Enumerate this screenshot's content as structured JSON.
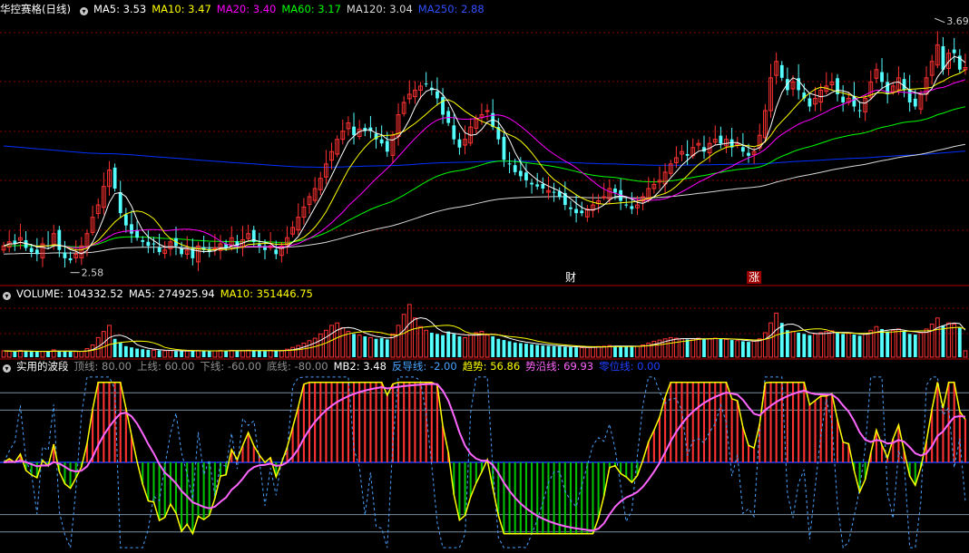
{
  "colors": {
    "up": "#ff3232",
    "down": "#54ffff",
    "ma5": "#ffffff",
    "ma10": "#ffff00",
    "ma20": "#ff00ff",
    "ma60": "#00ff00",
    "ma120": "#d8d8d8",
    "ma250": "#0030ff",
    "grid": "#8b0000",
    "axis": "#b00000"
  },
  "price_header": {
    "title": "华控赛格(日线)",
    "ma5": "MA5: 3.53",
    "ma10": "MA10: 3.47",
    "ma20": "MA20: 3.40",
    "ma60": "MA60: 3.17",
    "ma120": "MA120: 3.04",
    "ma250": "MA250: 2.88"
  },
  "volume_header": {
    "volume": "VOLUME: 104332.52",
    "ma5": "MA5: 274925.94",
    "ma10": "MA10: 351446.75"
  },
  "indicator_header": {
    "title": "实用的波段",
    "top": "顶线: 80.00",
    "upper": "上线: 60.00",
    "lower": "下线: -60.00",
    "bottom": "底线: -80.00",
    "mb2": "MB2: 3.48",
    "reverse": "反导线: -2.00",
    "trend": "趋势: 56.86",
    "edge": "势沿线: 69.93",
    "zero": "零位线: 0.00"
  },
  "chart_data": [
    {
      "type": "candlestick",
      "title": "华控赛格(日线)",
      "ylim": [
        2.48,
        3.78
      ],
      "annotations": [
        {
          "text": "3.69",
          "kind": "high"
        },
        {
          "text": "2.58",
          "kind": "low"
        },
        {
          "text": "财",
          "kind": "event"
        },
        {
          "text": "涨",
          "kind": "event"
        }
      ],
      "series": [
        {
          "name": "MA5",
          "value": 3.53
        },
        {
          "name": "MA10",
          "value": 3.47
        },
        {
          "name": "MA20",
          "value": 3.4
        },
        {
          "name": "MA60",
          "value": 3.17
        },
        {
          "name": "MA120",
          "value": 3.04
        },
        {
          "name": "MA250",
          "value": 2.88
        }
      ],
      "close": [
        2.66,
        2.68,
        2.67,
        2.7,
        2.65,
        2.63,
        2.62,
        2.67,
        2.66,
        2.72,
        2.64,
        2.6,
        2.59,
        2.62,
        2.66,
        2.72,
        2.8,
        2.86,
        2.95,
        3.03,
        2.94,
        2.82,
        2.76,
        2.72,
        2.7,
        2.68,
        2.66,
        2.67,
        2.63,
        2.64,
        2.68,
        2.66,
        2.62,
        2.64,
        2.6,
        2.66,
        2.64,
        2.63,
        2.65,
        2.67,
        2.65,
        2.7,
        2.66,
        2.69,
        2.72,
        2.68,
        2.66,
        2.64,
        2.66,
        2.62,
        2.66,
        2.7,
        2.75,
        2.8,
        2.85,
        2.9,
        2.94,
        2.99,
        3.06,
        3.12,
        3.18,
        3.22,
        3.26,
        3.2,
        3.23,
        3.22,
        3.22,
        3.18,
        3.16,
        3.12,
        3.2,
        3.3,
        3.36,
        3.4,
        3.42,
        3.44,
        3.45,
        3.42,
        3.38,
        3.3,
        3.26,
        3.18,
        3.14,
        3.18,
        3.24,
        3.28,
        3.3,
        3.32,
        3.24,
        3.18,
        3.08,
        3.06,
        3.02,
        3.0,
        2.98,
        2.96,
        2.95,
        2.94,
        2.93,
        2.92,
        2.9,
        2.86,
        2.84,
        2.82,
        2.82,
        2.84,
        2.86,
        2.88,
        2.9,
        2.94,
        2.92,
        2.88,
        2.86,
        2.84,
        2.86,
        2.9,
        2.94,
        2.96,
        2.98,
        3.02,
        3.06,
        3.09,
        3.12,
        3.1,
        3.14,
        3.16,
        3.12,
        3.16,
        3.18,
        3.16,
        3.18,
        3.14,
        3.16,
        3.12,
        3.1,
        3.12,
        3.2,
        3.32,
        3.48,
        3.56,
        3.48,
        3.42,
        3.46,
        3.42,
        3.38,
        3.34,
        3.38,
        3.42,
        3.44,
        3.46,
        3.4,
        3.36,
        3.38,
        3.34,
        3.32,
        3.38,
        3.46,
        3.52,
        3.46,
        3.4,
        3.44,
        3.48,
        3.42,
        3.36,
        3.34,
        3.4,
        3.48,
        3.56,
        3.64,
        3.52,
        3.6,
        3.6,
        3.52,
        3.53
      ],
      "volume": [
        104000,
        98000,
        92000,
        110000,
        96000,
        90000,
        88000,
        95000,
        92000,
        120000,
        100000,
        94000,
        90000,
        92000,
        96000,
        140000,
        200000,
        320000,
        420000,
        520000,
        300000,
        240000,
        180000,
        160000,
        140000,
        130000,
        120000,
        115000,
        110000,
        105000,
        108000,
        100000,
        96000,
        102000,
        110000,
        108000,
        100000,
        98000,
        104000,
        110000,
        106000,
        112000,
        100000,
        108000,
        114000,
        110000,
        104000,
        98000,
        112000,
        104000,
        110000,
        130000,
        160000,
        190000,
        230000,
        270000,
        310000,
        380000,
        440000,
        520000,
        560000,
        480000,
        420000,
        380000,
        360000,
        340000,
        320000,
        300000,
        310000,
        290000,
        380000,
        520000,
        700000,
        860000,
        640000,
        500000,
        440000,
        400000,
        380000,
        360000,
        420000,
        380000,
        340000,
        320000,
        360000,
        400000,
        420000,
        360000,
        340000,
        300000,
        280000,
        260000,
        240000,
        230000,
        220000,
        210000,
        200000,
        190000,
        185000,
        180000,
        175000,
        170000,
        165000,
        160000,
        155000,
        160000,
        170000,
        175000,
        180000,
        190000,
        185000,
        180000,
        175000,
        170000,
        180000,
        200000,
        230000,
        260000,
        280000,
        300000,
        320000,
        310000,
        300000,
        290000,
        300000,
        310000,
        300000,
        300000,
        310000,
        300000,
        290000,
        280000,
        270000,
        260000,
        250000,
        260000,
        300000,
        400000,
        560000,
        720000,
        560000,
        440000,
        420000,
        400000,
        380000,
        360000,
        380000,
        400000,
        420000,
        430000,
        400000,
        380000,
        390000,
        370000,
        350000,
        380000,
        440000,
        500000,
        460000,
        420000,
        440000,
        460000,
        420000,
        380000,
        370000,
        400000,
        460000,
        540000,
        640000,
        520000,
        560000,
        540000,
        480000,
        104332
      ],
      "volume_series": [
        {
          "name": "MA5",
          "value": 274925.94
        },
        {
          "name": "MA10",
          "value": 351446.75
        }
      ]
    },
    {
      "type": "line",
      "title": "实用的波段",
      "ylim": [
        -100,
        100
      ],
      "reference_lines": [
        {
          "name": "顶线",
          "value": 80
        },
        {
          "name": "上线",
          "value": 60
        },
        {
          "name": "零位线",
          "value": 0
        },
        {
          "name": "下线",
          "value": -60
        },
        {
          "name": "底线",
          "value": -80
        }
      ],
      "series": [
        {
          "name": "MB2",
          "value": 3.48
        },
        {
          "name": "反导线",
          "value": -2.0
        },
        {
          "name": "趋势",
          "value": 56.86
        },
        {
          "name": "势沿线",
          "value": 69.93
        }
      ]
    }
  ]
}
